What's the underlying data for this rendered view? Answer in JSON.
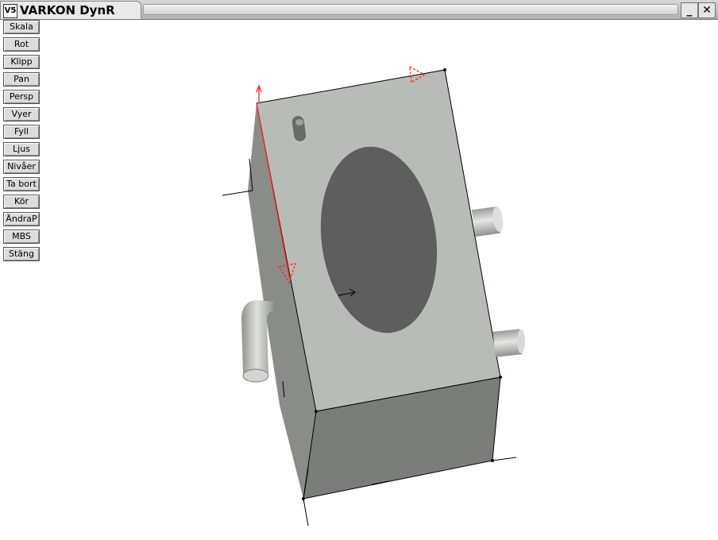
{
  "window": {
    "title": "VARKON DynR",
    "icon_text": "V5",
    "minimize_label": "_",
    "close_label": "✕"
  },
  "toolbar": {
    "buttons": [
      "Skala",
      "Rot",
      "Klipp",
      "Pan",
      "Persp",
      "Vyer",
      "Fyll",
      "Ljus",
      "Nivåer",
      "Ta bort",
      "Kör",
      "ÄndraP",
      "MBS",
      "Stäng"
    ]
  },
  "scene": {
    "model": "box-with-ellipse-and-pipes",
    "colors": {
      "front_face": "#b7bbb5",
      "bottom_face": "#7b7d7a",
      "side_face": "#8c8e8b",
      "ellipse": "#5f5f5f",
      "pipe": "#c4c8c3",
      "highlight_edge": "#ff0000"
    }
  }
}
